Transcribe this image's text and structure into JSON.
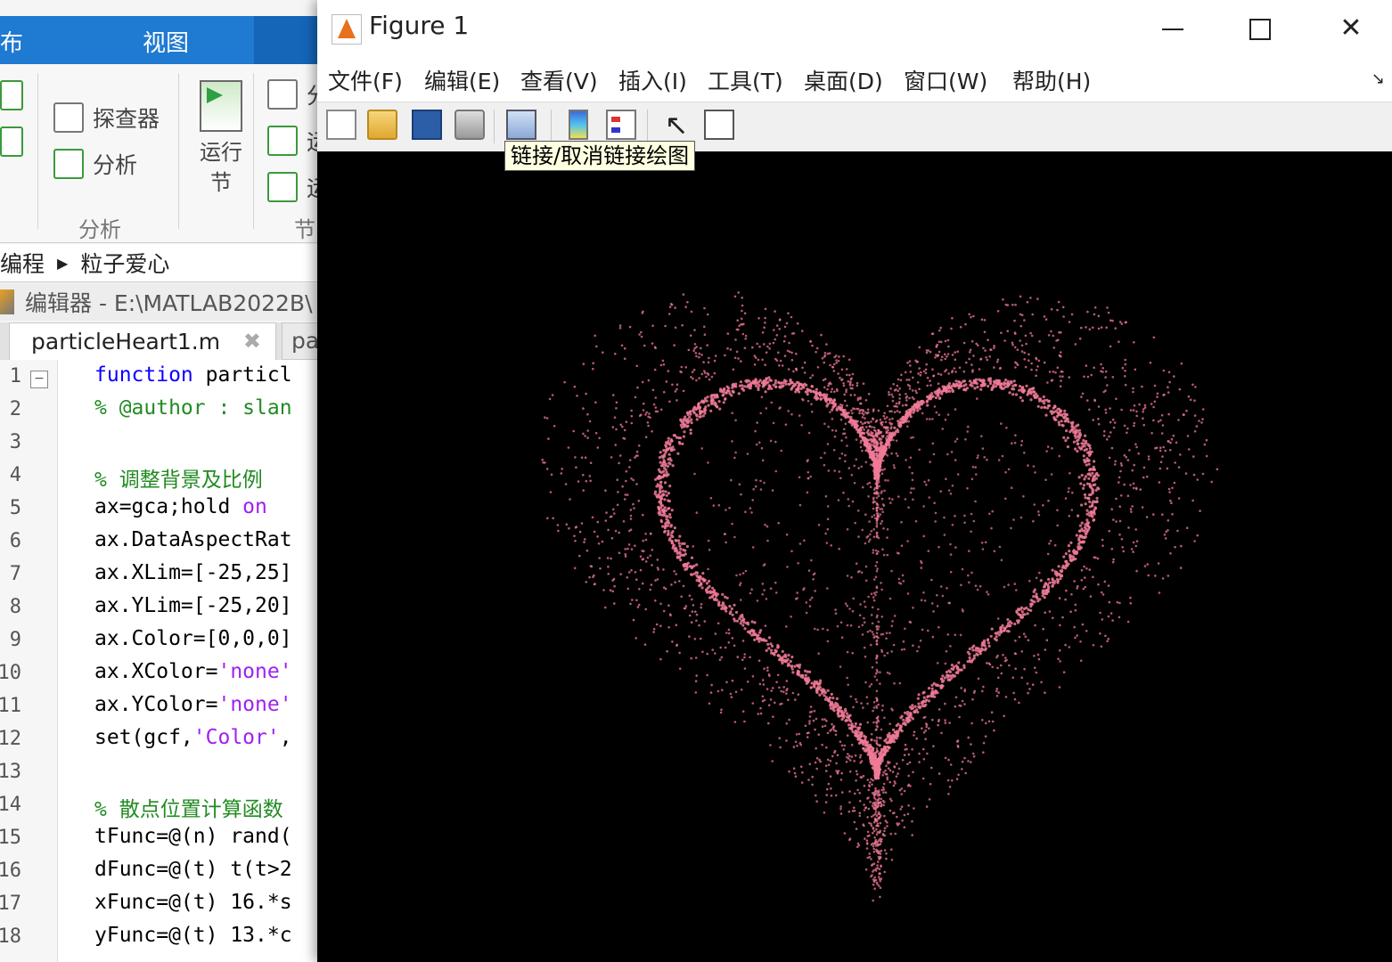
{
  "matlab": {
    "tabs": {
      "publish": "布",
      "view": "视图"
    },
    "ribbon": {
      "explorer": "探查器",
      "analyze": "分析",
      "run_section_line1": "运行",
      "run_section_line2": "节",
      "group_analyze": "分析",
      "group_section": "节",
      "cut_glyph_1": "分",
      "cut_glyph_2": "运",
      "cut_glyph_3": "运"
    },
    "breadcrumb": {
      "parent": "编程",
      "current": "粒子爱心"
    },
    "editor_title": "编辑器 - E:\\MATLAB2022B\\",
    "file_tabs": {
      "active": "particleHeart1.m",
      "close": "✖",
      "next": "pa"
    },
    "line_numbers": [
      "1",
      "2",
      "3",
      "4",
      "5",
      "6",
      "7",
      "8",
      "9",
      "10",
      "11",
      "12",
      "13",
      "14",
      "15",
      "16",
      "17",
      "18"
    ],
    "code": {
      "l1_kw": "function",
      "l1_rest": " particl",
      "l2": "% @author : slan",
      "l4": "% 调整背景及比例",
      "l5_a": "ax=gca;hold ",
      "l5_b": "on",
      "l6": "ax.DataAspectRat",
      "l7": "ax.XLim=[-25,25]",
      "l8": "ax.YLim=[-25,20]",
      "l9": "ax.Color=[0,0,0]",
      "l10_a": "ax.XColor=",
      "l10_b": "'none'",
      "l11_a": "ax.YColor=",
      "l11_b": "'none'",
      "l12_a": "set(gcf,",
      "l12_b": "'Color'",
      "l12_c": ",",
      "l14": "% 散点位置计算函数",
      "l15": "tFunc=@(n) rand(",
      "l16": "dFunc=@(t) t(t>2",
      "l17": "xFunc=@(t) 16.*s",
      "l18": "yFunc=@(t) 13.*c"
    }
  },
  "figure": {
    "title": "Figure 1",
    "window_buttons": {
      "close": "✕"
    },
    "menu": [
      "文件(F)",
      "编辑(E)",
      "查看(V)",
      "插入(I)",
      "工具(T)",
      "桌面(D)",
      "窗口(W)",
      "帮助(H)"
    ],
    "menu_corner": "↘",
    "toolbar_icons": [
      "new-file-icon",
      "open-folder-icon",
      "save-icon",
      "print-icon",
      "link-plot-icon",
      "colorbar-icon",
      "legend-icon",
      "pointer-icon",
      "property-panel-icon"
    ],
    "pointer_glyph": "↖",
    "tooltip": "链接/取消链接绘图",
    "plot": {
      "background": "#000000",
      "particle_color": "#f07a96",
      "xlim": [
        -25,
        25
      ],
      "ylim": [
        -25,
        20
      ]
    }
  }
}
